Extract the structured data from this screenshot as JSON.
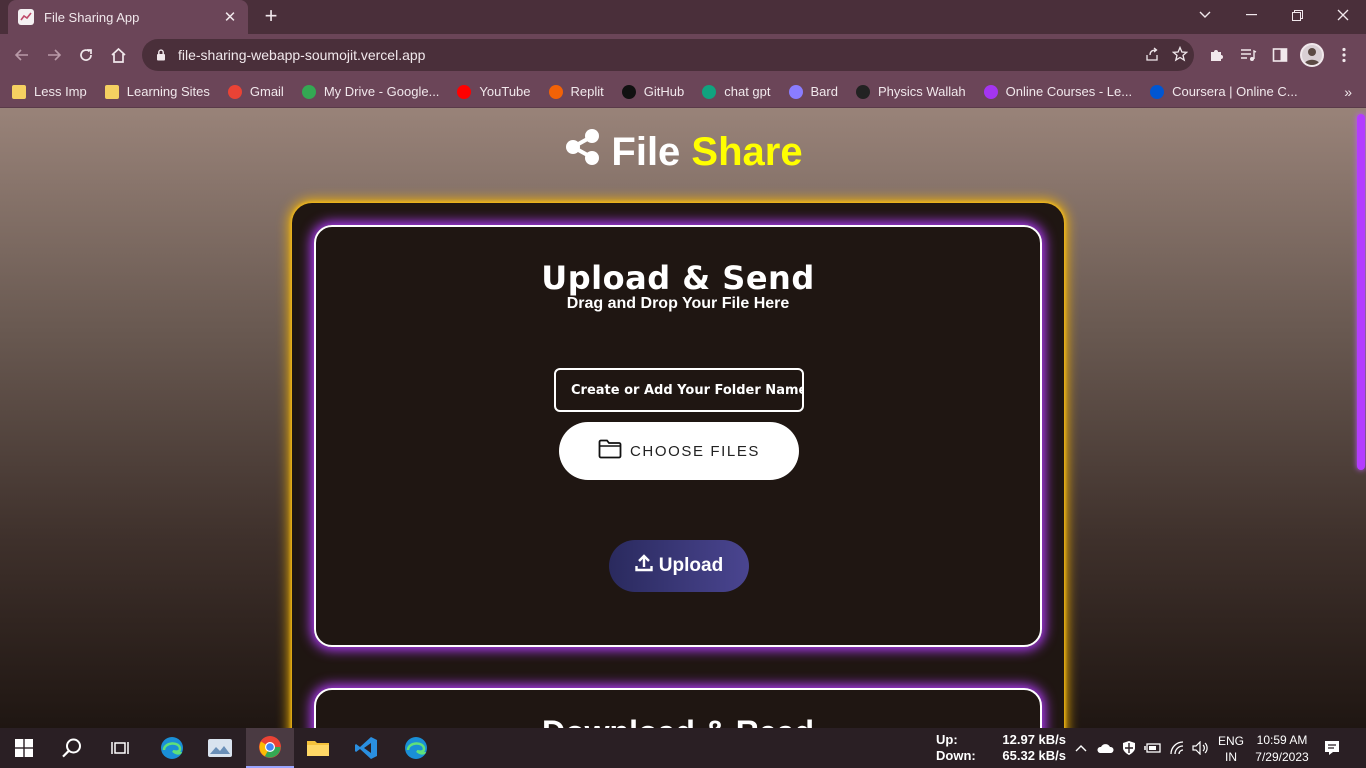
{
  "browser": {
    "tab_title": "File Sharing App",
    "tab_close": "✕",
    "new_tab": "+",
    "url": "file-sharing-webapp-soumojit.vercel.app",
    "bookmarks": [
      {
        "label": "Less Imp",
        "icon": "folder-icon",
        "color": "#f5d061"
      },
      {
        "label": "Learning Sites",
        "icon": "folder-icon",
        "color": "#f5d061"
      },
      {
        "label": "Gmail",
        "icon": "gmail-icon",
        "color": "#ea4335"
      },
      {
        "label": "My Drive - Google...",
        "icon": "drive-icon",
        "color": "#34a853"
      },
      {
        "label": "YouTube",
        "icon": "youtube-icon",
        "color": "#ff0000"
      },
      {
        "label": "Replit",
        "icon": "replit-icon",
        "color": "#f26207"
      },
      {
        "label": "GitHub",
        "icon": "github-icon",
        "color": "#111111"
      },
      {
        "label": "chat gpt",
        "icon": "chatgpt-icon",
        "color": "#10a37f"
      },
      {
        "label": "Bard",
        "icon": "bard-icon",
        "color": "#8a7dff"
      },
      {
        "label": "Physics Wallah",
        "icon": "pw-icon",
        "color": "#222222"
      },
      {
        "label": "Online Courses - Le...",
        "icon": "udemy-icon",
        "color": "#a435f0"
      },
      {
        "label": "Coursera | Online C...",
        "icon": "coursera-icon",
        "color": "#0056d2"
      }
    ],
    "bookmarks_more": "»"
  },
  "page": {
    "brand_first": "File",
    "brand_second": "Share",
    "upload_heading": "Upload & Send",
    "upload_sub": "Drag and Drop Your File Here",
    "folder_placeholder": "Create or Add Your Folder Name",
    "choose_files_label": "CHOOSE FILES",
    "upload_label": "Upload",
    "next_section_heading": "Download & Read"
  },
  "taskbar": {
    "net_up_label": "Up:",
    "net_up_value": "12.97 kB/s",
    "net_down_label": "Down:",
    "net_down_value": "65.32 kB/s",
    "lang_top": "ENG",
    "lang_bottom": "IN",
    "time": "10:59 AM",
    "date": "7/29/2023"
  },
  "colors": {
    "brand_accent": "#ffff00",
    "outer_glow": "#f5b400",
    "inner_glow": "#b43cff"
  }
}
